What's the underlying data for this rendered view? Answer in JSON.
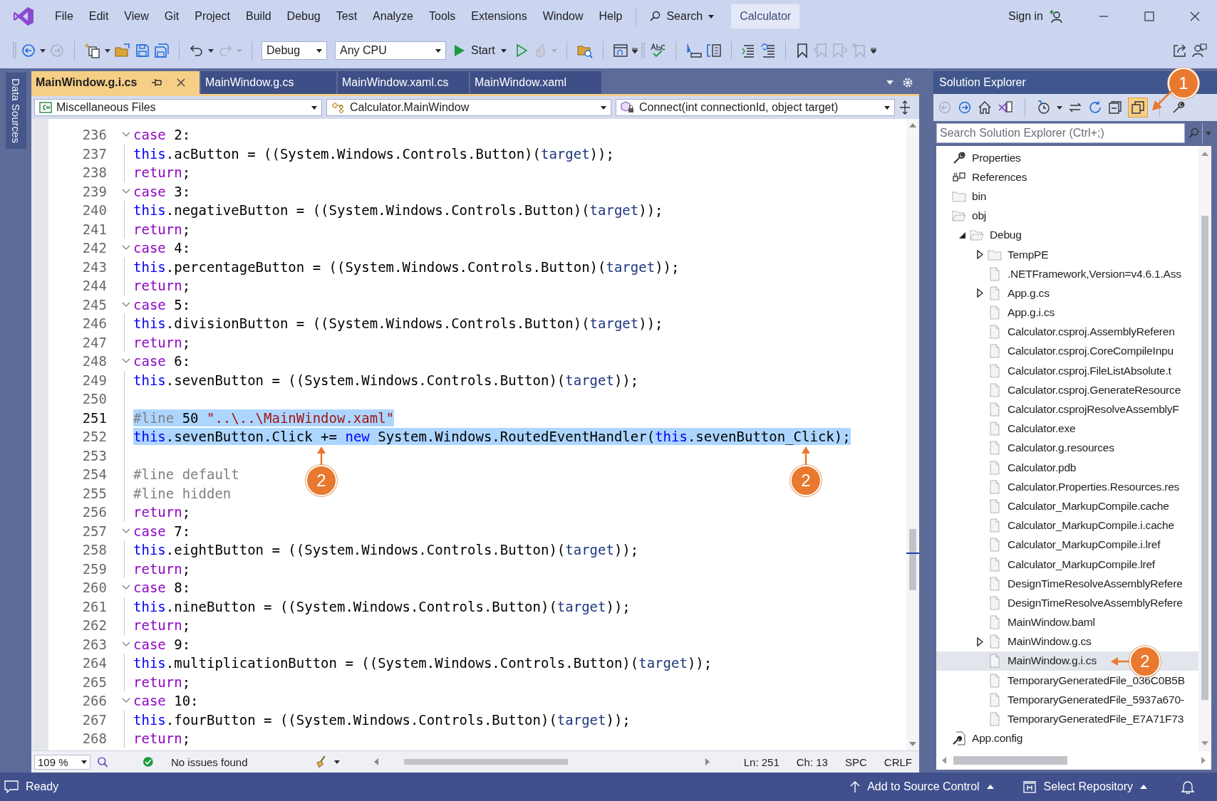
{
  "window": {
    "menu": [
      "File",
      "Edit",
      "View",
      "Git",
      "Project",
      "Build",
      "Debug",
      "Test",
      "Analyze",
      "Tools",
      "Extensions",
      "Window",
      "Help"
    ],
    "search": "Search",
    "solution_name": "Calculator",
    "sign_in": "Sign in"
  },
  "toolbar": {
    "configuration": "Debug",
    "platform": "Any CPU",
    "start": "Start"
  },
  "side_tab": "Data Sources",
  "document_tabs": [
    {
      "label": "MainWindow.g.i.cs",
      "selected": true
    },
    {
      "label": "MainWindow.g.cs",
      "selected": false
    },
    {
      "label": "MainWindow.xaml.cs",
      "selected": false
    },
    {
      "label": "MainWindow.xaml",
      "selected": false
    }
  ],
  "navigation_bar": {
    "project": "Miscellaneous Files",
    "type": "Calculator.MainWindow",
    "member": "Connect(int connectionId, object target)"
  },
  "code_lines": [
    {
      "number": "236",
      "fold": true,
      "selected": false,
      "current": false,
      "tokens": [
        {
          "t": "case",
          "kind": "kw"
        },
        {
          "t": " 2:",
          "kind": "plain"
        }
      ]
    },
    {
      "number": "237",
      "fold": false,
      "selected": false,
      "current": false,
      "tokens": [
        {
          "t": "this",
          "kind": "blue"
        },
        {
          "t": ".acButton = ((System.Windows.Controls.Button)(",
          "kind": "plain"
        },
        {
          "t": "target",
          "kind": "param"
        },
        {
          "t": "));",
          "kind": "plain"
        }
      ]
    },
    {
      "number": "238",
      "fold": false,
      "selected": false,
      "current": false,
      "tokens": [
        {
          "t": "return",
          "kind": "kw"
        },
        {
          "t": ";",
          "kind": "plain"
        }
      ]
    },
    {
      "number": "239",
      "fold": true,
      "selected": false,
      "current": false,
      "tokens": [
        {
          "t": "case",
          "kind": "kw"
        },
        {
          "t": " 3:",
          "kind": "plain"
        }
      ]
    },
    {
      "number": "240",
      "fold": false,
      "selected": false,
      "current": false,
      "tokens": [
        {
          "t": "this",
          "kind": "blue"
        },
        {
          "t": ".negativeButton = ((System.Windows.Controls.Button)(",
          "kind": "plain"
        },
        {
          "t": "target",
          "kind": "param"
        },
        {
          "t": "));",
          "kind": "plain"
        }
      ]
    },
    {
      "number": "241",
      "fold": false,
      "selected": false,
      "current": false,
      "tokens": [
        {
          "t": "return",
          "kind": "kw"
        },
        {
          "t": ";",
          "kind": "plain"
        }
      ]
    },
    {
      "number": "242",
      "fold": true,
      "selected": false,
      "current": false,
      "tokens": [
        {
          "t": "case",
          "kind": "kw"
        },
        {
          "t": " 4:",
          "kind": "plain"
        }
      ]
    },
    {
      "number": "243",
      "fold": false,
      "selected": false,
      "current": false,
      "tokens": [
        {
          "t": "this",
          "kind": "blue"
        },
        {
          "t": ".percentageButton = ((System.Windows.Controls.Button)(",
          "kind": "plain"
        },
        {
          "t": "target",
          "kind": "param"
        },
        {
          "t": "));",
          "kind": "plain"
        }
      ]
    },
    {
      "number": "244",
      "fold": false,
      "selected": false,
      "current": false,
      "tokens": [
        {
          "t": "return",
          "kind": "kw"
        },
        {
          "t": ";",
          "kind": "plain"
        }
      ]
    },
    {
      "number": "245",
      "fold": true,
      "selected": false,
      "current": false,
      "tokens": [
        {
          "t": "case",
          "kind": "kw"
        },
        {
          "t": " 5:",
          "kind": "plain"
        }
      ]
    },
    {
      "number": "246",
      "fold": false,
      "selected": false,
      "current": false,
      "tokens": [
        {
          "t": "this",
          "kind": "blue"
        },
        {
          "t": ".divisionButton = ((System.Windows.Controls.Button)(",
          "kind": "plain"
        },
        {
          "t": "target",
          "kind": "param"
        },
        {
          "t": "));",
          "kind": "plain"
        }
      ]
    },
    {
      "number": "247",
      "fold": false,
      "selected": false,
      "current": false,
      "tokens": [
        {
          "t": "return",
          "kind": "kw"
        },
        {
          "t": ";",
          "kind": "plain"
        }
      ]
    },
    {
      "number": "248",
      "fold": true,
      "selected": false,
      "current": false,
      "tokens": [
        {
          "t": "case",
          "kind": "kw"
        },
        {
          "t": " 6:",
          "kind": "plain"
        }
      ]
    },
    {
      "number": "249",
      "fold": false,
      "selected": false,
      "current": false,
      "tokens": [
        {
          "t": "this",
          "kind": "blue"
        },
        {
          "t": ".sevenButton = ((System.Windows.Controls.Button)(",
          "kind": "plain"
        },
        {
          "t": "target",
          "kind": "param"
        },
        {
          "t": "));",
          "kind": "plain"
        }
      ]
    },
    {
      "number": "250",
      "fold": false,
      "selected": false,
      "current": false
    },
    {
      "number": "251",
      "fold": false,
      "selected": true,
      "current": true,
      "tokens": [
        {
          "t": "#line",
          "kind": "dir"
        },
        {
          "t": " 50 ",
          "kind": "plain"
        },
        {
          "t": "\"..\\..\\MainWindow.xaml\"",
          "kind": "str"
        }
      ]
    },
    {
      "number": "252",
      "fold": false,
      "selected": true,
      "current": false,
      "tokens": [
        {
          "t": "this",
          "kind": "blue"
        },
        {
          "t": ".sevenButton.Click += ",
          "kind": "plain"
        },
        {
          "t": "new",
          "kind": "blue"
        },
        {
          "t": " System.Windows.RoutedEventHandler(",
          "kind": "plain"
        },
        {
          "t": "this",
          "kind": "blue"
        },
        {
          "t": ".sevenButton_Click);",
          "kind": "plain"
        }
      ]
    },
    {
      "number": "253",
      "fold": false,
      "selected": false,
      "current": false
    },
    {
      "number": "254",
      "fold": false,
      "selected": false,
      "current": false,
      "tokens": [
        {
          "t": "#line default",
          "kind": "dir"
        }
      ]
    },
    {
      "number": "255",
      "fold": false,
      "selected": false,
      "current": false,
      "tokens": [
        {
          "t": "#line hidden",
          "kind": "dir"
        }
      ]
    },
    {
      "number": "256",
      "fold": false,
      "selected": false,
      "current": false,
      "tokens": [
        {
          "t": "return",
          "kind": "kw"
        },
        {
          "t": ";",
          "kind": "plain"
        }
      ]
    },
    {
      "number": "257",
      "fold": true,
      "selected": false,
      "current": false,
      "tokens": [
        {
          "t": "case",
          "kind": "kw"
        },
        {
          "t": " 7:",
          "kind": "plain"
        }
      ]
    },
    {
      "number": "258",
      "fold": false,
      "selected": false,
      "current": false,
      "tokens": [
        {
          "t": "this",
          "kind": "blue"
        },
        {
          "t": ".eightButton = ((System.Windows.Controls.Button)(",
          "kind": "plain"
        },
        {
          "t": "target",
          "kind": "param"
        },
        {
          "t": "));",
          "kind": "plain"
        }
      ]
    },
    {
      "number": "259",
      "fold": false,
      "selected": false,
      "current": false,
      "tokens": [
        {
          "t": "return",
          "kind": "kw"
        },
        {
          "t": ";",
          "kind": "plain"
        }
      ]
    },
    {
      "number": "260",
      "fold": true,
      "selected": false,
      "current": false,
      "tokens": [
        {
          "t": "case",
          "kind": "kw"
        },
        {
          "t": " 8:",
          "kind": "plain"
        }
      ]
    },
    {
      "number": "261",
      "fold": false,
      "selected": false,
      "current": false,
      "tokens": [
        {
          "t": "this",
          "kind": "blue"
        },
        {
          "t": ".nineButton = ((System.Windows.Controls.Button)(",
          "kind": "plain"
        },
        {
          "t": "target",
          "kind": "param"
        },
        {
          "t": "));",
          "kind": "plain"
        }
      ]
    },
    {
      "number": "262",
      "fold": false,
      "selected": false,
      "current": false,
      "tokens": [
        {
          "t": "return",
          "kind": "kw"
        },
        {
          "t": ";",
          "kind": "plain"
        }
      ]
    },
    {
      "number": "263",
      "fold": true,
      "selected": false,
      "current": false,
      "tokens": [
        {
          "t": "case",
          "kind": "kw"
        },
        {
          "t": " 9:",
          "kind": "plain"
        }
      ]
    },
    {
      "number": "264",
      "fold": false,
      "selected": false,
      "current": false,
      "tokens": [
        {
          "t": "this",
          "kind": "blue"
        },
        {
          "t": ".multiplicationButton = ((System.Windows.Controls.Button)(",
          "kind": "plain"
        },
        {
          "t": "target",
          "kind": "param"
        },
        {
          "t": "));",
          "kind": "plain"
        }
      ]
    },
    {
      "number": "265",
      "fold": false,
      "selected": false,
      "current": false,
      "tokens": [
        {
          "t": "return",
          "kind": "kw"
        },
        {
          "t": ";",
          "kind": "plain"
        }
      ]
    },
    {
      "number": "266",
      "fold": true,
      "selected": false,
      "current": false,
      "tokens": [
        {
          "t": "case",
          "kind": "kw"
        },
        {
          "t": " 10:",
          "kind": "plain"
        }
      ]
    },
    {
      "number": "267",
      "fold": false,
      "selected": false,
      "current": false,
      "tokens": [
        {
          "t": "this",
          "kind": "blue"
        },
        {
          "t": ".fourButton = ((System.Windows.Controls.Button)(",
          "kind": "plain"
        },
        {
          "t": "target",
          "kind": "param"
        },
        {
          "t": "));",
          "kind": "plain"
        }
      ]
    },
    {
      "number": "268",
      "fold": false,
      "selected": false,
      "current": false,
      "tokens": [
        {
          "t": "return",
          "kind": "kw"
        },
        {
          "t": ";",
          "kind": "plain"
        }
      ]
    }
  ],
  "editor_status": {
    "zoom": "109 %",
    "issues": "No issues found",
    "line": "Ln: 251",
    "column": "Ch: 13",
    "indent": "SPC",
    "line_endings": "CRLF"
  },
  "solution_explorer": {
    "title": "Solution Explorer",
    "search_placeholder": "Search Solution Explorer (Ctrl+;)",
    "tree": [
      {
        "label": "Properties",
        "kind": "properties",
        "selected": false
      },
      {
        "label": "References",
        "kind": "references",
        "selected": false
      },
      {
        "label": "bin",
        "kind": "folder",
        "selected": false
      },
      {
        "label": "obj",
        "kind": "folder-open",
        "selected": false,
        "children": [
          {
            "label": "Debug",
            "kind": "folder-open",
            "expanded": true,
            "selected": false,
            "children": [
              {
                "label": "TempPE",
                "kind": "folder",
                "expanded": false,
                "selected": false
              },
              {
                "label": ".NETFramework,Version=v4.6.1.Ass",
                "kind": "file",
                "selected": false
              },
              {
                "label": "App.g.cs",
                "kind": "file",
                "expanded": false,
                "selected": false
              },
              {
                "label": "App.g.i.cs",
                "kind": "file",
                "selected": false
              },
              {
                "label": "Calculator.csproj.AssemblyReferen",
                "kind": "file",
                "selected": false
              },
              {
                "label": "Calculator.csproj.CoreCompileInpu",
                "kind": "file",
                "selected": false
              },
              {
                "label": "Calculator.csproj.FileListAbsolute.t",
                "kind": "file",
                "selected": false
              },
              {
                "label": "Calculator.csproj.GenerateResource",
                "kind": "file",
                "selected": false
              },
              {
                "label": "Calculator.csprojResolveAssemblyF",
                "kind": "file",
                "selected": false
              },
              {
                "label": "Calculator.exe",
                "kind": "file",
                "selected": false
              },
              {
                "label": "Calculator.g.resources",
                "kind": "file",
                "selected": false
              },
              {
                "label": "Calculator.pdb",
                "kind": "file",
                "selected": false
              },
              {
                "label": "Calculator.Properties.Resources.res",
                "kind": "file",
                "selected": false
              },
              {
                "label": "Calculator_MarkupCompile.cache",
                "kind": "file",
                "selected": false
              },
              {
                "label": "Calculator_MarkupCompile.i.cache",
                "kind": "file",
                "selected": false
              },
              {
                "label": "Calculator_MarkupCompile.i.lref",
                "kind": "file",
                "selected": false
              },
              {
                "label": "Calculator_MarkupCompile.lref",
                "kind": "file",
                "selected": false
              },
              {
                "label": "DesignTimeResolveAssemblyRefere",
                "kind": "file",
                "selected": false
              },
              {
                "label": "DesignTimeResolveAssemblyRefere",
                "kind": "file",
                "selected": false
              },
              {
                "label": "MainWindow.baml",
                "kind": "file",
                "selected": false
              },
              {
                "label": "MainWindow.g.cs",
                "kind": "file",
                "expanded": false,
                "selected": false
              },
              {
                "label": "MainWindow.g.i.cs",
                "kind": "file",
                "selected": true
              },
              {
                "label": "TemporaryGeneratedFile_036C0B5B",
                "kind": "file",
                "selected": false
              },
              {
                "label": "TemporaryGeneratedFile_5937a670-",
                "kind": "file",
                "selected": false
              },
              {
                "label": "TemporaryGeneratedFile_E7A71F73",
                "kind": "file",
                "selected": false
              }
            ]
          }
        ]
      },
      {
        "label": "App.config",
        "kind": "config",
        "selected": false
      }
    ]
  },
  "status_bar": {
    "state": "Ready",
    "source_control": "Add to Source Control",
    "repository": "Select Repository"
  },
  "callouts": [
    {
      "label": "1"
    },
    {
      "label": "2"
    },
    {
      "label": "2"
    },
    {
      "label": "2"
    }
  ]
}
